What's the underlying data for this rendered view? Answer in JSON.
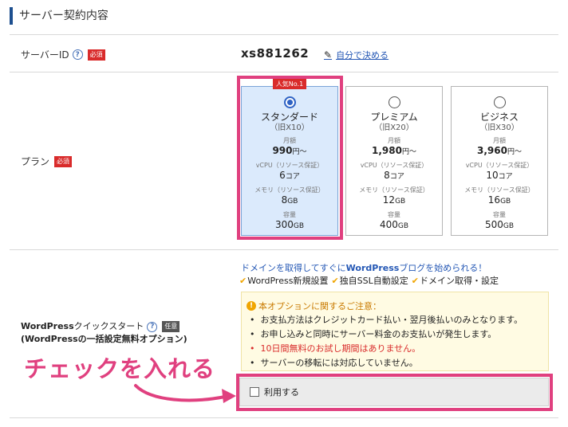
{
  "section_title": "サーバー契約内容",
  "server_row": {
    "label": "サーバーID",
    "help_glyph": "?",
    "required_badge": "必須",
    "server_id": "xs881262",
    "pencil_icon": "pencil-icon",
    "custom_link": "自分で決める"
  },
  "plan_row": {
    "label": "プラン",
    "required_badge": "必須",
    "popular_tag": "人気No.1",
    "plans": [
      {
        "name": "スタンダード",
        "old": "（旧X10）",
        "monthly_label": "月額",
        "price": "990",
        "price_suffix": "円～",
        "vcpu_label": "vCPU（リソース保証）",
        "vcpu": "6",
        "vcpu_unit": "コア",
        "memory_label": "メモリ（リソース保証）",
        "memory": "8",
        "memory_unit": "GB",
        "storage_label": "容量",
        "storage": "300",
        "storage_unit": "GB",
        "selected": true
      },
      {
        "name": "プレミアム",
        "old": "（旧X20）",
        "monthly_label": "月額",
        "price": "1,980",
        "price_suffix": "円～",
        "vcpu_label": "vCPU（リソース保証）",
        "vcpu": "8",
        "vcpu_unit": "コア",
        "memory_label": "メモリ（リソース保証）",
        "memory": "12",
        "memory_unit": "GB",
        "storage_label": "容量",
        "storage": "400",
        "storage_unit": "GB",
        "selected": false
      },
      {
        "name": "ビジネス",
        "old": "（旧X30）",
        "monthly_label": "月額",
        "price": "3,960",
        "price_suffix": "円～",
        "vcpu_label": "vCPU（リソース保証）",
        "vcpu": "10",
        "vcpu_unit": "コア",
        "memory_label": "メモリ（リソース保証）",
        "memory": "16",
        "memory_unit": "GB",
        "storage_label": "容量",
        "storage": "500",
        "storage_unit": "GB",
        "selected": false
      }
    ]
  },
  "wp_row": {
    "label_line1_bold": "WordPress",
    "label_line1_rest": "クイックスタート",
    "help_glyph": "?",
    "optional_badge": "任意",
    "label_line2": "(WordPressの一括設定無料オプション)",
    "headline_pre": "ドメインを取得してすぐに",
    "headline_bold": "WordPress",
    "headline_post": "ブログを始められる！",
    "features": [
      "WordPress新規設置",
      "独自SSL自動設定",
      "ドメイン取得・設定"
    ],
    "notice_title": "本オプションに関するご注意：",
    "warn_glyph": "!",
    "notices": [
      "お支払方法はクレジットカード払い・翌月後払いのみとなります。",
      "お申し込みと同時にサーバー料金のお支払いが発生します。",
      "10日間無料のお試し期間はありません。",
      "サーバーの移転には対応していません。"
    ],
    "use_checkbox_label": "利用する",
    "callout": "チェックを入れる"
  },
  "colors": {
    "accent_pink": "#e0407f",
    "required_red": "#d92b2b",
    "link_blue": "#2558b5",
    "selected_bg": "#dbeafc"
  }
}
